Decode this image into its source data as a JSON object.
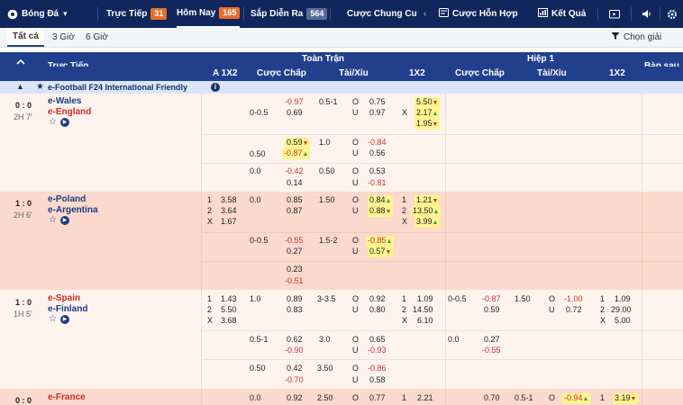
{
  "nav": {
    "sport": "Bóng Đá",
    "live": "Trực Tiếp",
    "live_count": "31",
    "today": "Hôm Nay",
    "today_count": "165",
    "upcoming": "Sắp Diễn Ra",
    "upcoming_count": "564",
    "outright": "Cược Chung Cu",
    "parlay": "Cược Hỗn Hợp",
    "results": "Kết Quả"
  },
  "sub": {
    "all": "Tất cả",
    "h3": "3 Giờ",
    "h6": "6 Giờ",
    "choose_league": "Chọn giải"
  },
  "header": {
    "live": "Trực Tiếp",
    "full_time": "Toàn Trận",
    "first_half": "Hiệp 1",
    "col_1x2_a": "A 1X2",
    "handicap": "Cược Chấp",
    "over_under": "Tài/Xỉu",
    "col_1x2": "1X2",
    "corner": "Bàn sau",
    "ou_o": "O",
    "ou_u": "U"
  },
  "league": {
    "name": "e-Football F24 International Friendly"
  },
  "matches": [
    {
      "score": "0 : 0",
      "time": "2H 7'",
      "home": "e-Wales",
      "away": "e-England",
      "rows": [
        {
          "ah_line": "0-0.5",
          "ah_h": "-0.97",
          "ah_a": "0.69",
          "ou_line": "0.5-1",
          "o": "0.75",
          "u": "0.97",
          "x_1": "5.50",
          "x_2": "2.17",
          "x_x": "1.95"
        },
        {
          "ah_line": "0.50",
          "ah_h": "0.59",
          "ah_a": "-0.87",
          "ou_line": "1.0",
          "o": "-0.84",
          "u": "0.56"
        },
        {
          "ah_line": "0.0",
          "ah_h": "-0.42",
          "ah_a": "0.14",
          "ou_line": "0.50",
          "o": "0.53",
          "u": "-0.81"
        }
      ]
    },
    {
      "score": "1 : 0",
      "time": "2H 6'",
      "home": "e-Poland",
      "away": "e-Argentina",
      "pre_1": "3.58",
      "pre_2": "3.64",
      "pre_x": "1.67",
      "rows": [
        {
          "ah_line": "0.0",
          "ah_h": "0.85",
          "ah_a": "0.87",
          "ou_line": "1.50",
          "o": "0.84",
          "u": "0.88",
          "x_1": "1.21",
          "x_2": "13.50",
          "x_x": "3.99"
        },
        {
          "ah_line": "0-0.5",
          "ah_h": "-0.55",
          "ah_a": "0.27",
          "ou_line": "1.5-2",
          "o": "-0.85",
          "u": "0.57"
        },
        {
          "ah_h": "0.23",
          "ah_a": "-0.51"
        }
      ]
    },
    {
      "score": "1 : 0",
      "time": "1H 5'",
      "home": "e-Spain",
      "away": "e-Finland",
      "pre_1": "1.43",
      "pre_2": "5.50",
      "pre_x": "3.68",
      "rows": [
        {
          "ah_line": "1.0",
          "ah_h": "0.89",
          "ah_a": "0.83",
          "ou_line": "3-3.5",
          "o": "0.92",
          "u": "0.80",
          "x_1": "1.09",
          "x_2": "14.50",
          "x_x": "6.10",
          "h1_ah_line": "0-0.5",
          "h1_ah_h": "-0.87",
          "h1_ah_a": "0.59",
          "h1_ou_line": "1.50",
          "h1_o": "-1.00",
          "h1_u": "0.72",
          "h1_1": "1.09",
          "h1_2": "29.00",
          "h1_x": "5.00"
        },
        {
          "ah_line": "0.5-1",
          "ah_h": "0.62",
          "ah_a": "-0.90",
          "ou_line": "3.0",
          "o": "0.65",
          "u": "-0.93",
          "h1_ah_line": "0.0",
          "h1_ah_h": "0.27",
          "h1_ah_a": "-0.55"
        },
        {
          "ah_line": "0.50",
          "ah_h": "0.42",
          "ah_a": "-0.70",
          "ou_line": "3.50",
          "o": "-0.86",
          "u": "0.58"
        }
      ]
    },
    {
      "score": "0 : 0",
      "home": "e-France",
      "rows": [
        {
          "ah_line": "0.0",
          "ah_h": "0.92",
          "ou_line": "2.50",
          "o": "0.77",
          "x_1": "2.21",
          "h1_ah_h": "0.70",
          "h1_ou_line": "0.5-1",
          "h1_o": "-0.94",
          "h1_1": "3.19"
        }
      ]
    }
  ]
}
